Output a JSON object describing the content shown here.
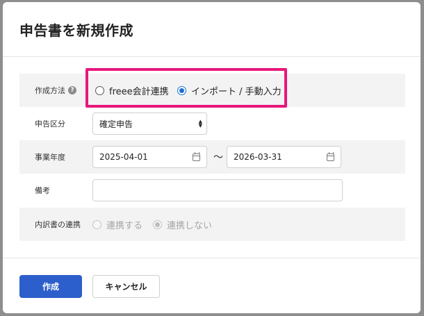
{
  "dialog": {
    "title": "申告書を新規作成"
  },
  "form": {
    "method": {
      "label": "作成方法",
      "help_icon": "?",
      "options": [
        {
          "label": "freee会計連携",
          "selected": false
        },
        {
          "label": "インポート / 手動入力",
          "selected": true
        }
      ]
    },
    "category": {
      "label": "申告区分",
      "value": "確定申告"
    },
    "fiscal_year": {
      "label": "事業年度",
      "start": "2025-04-01",
      "separator": "～",
      "end": "2026-03-31"
    },
    "notes": {
      "label": "備考",
      "value": ""
    },
    "breakdown_link": {
      "label": "内訳書の連携",
      "options": [
        {
          "label": "連携する",
          "selected": false,
          "disabled": true
        },
        {
          "label": "連携しない",
          "selected": true,
          "disabled": true
        }
      ]
    }
  },
  "footer": {
    "create_label": "作成",
    "cancel_label": "キャンセル"
  },
  "colors": {
    "accent": "#2c5fcb",
    "radio_selected": "#1a6fd6",
    "highlight_border": "#e8177c"
  }
}
